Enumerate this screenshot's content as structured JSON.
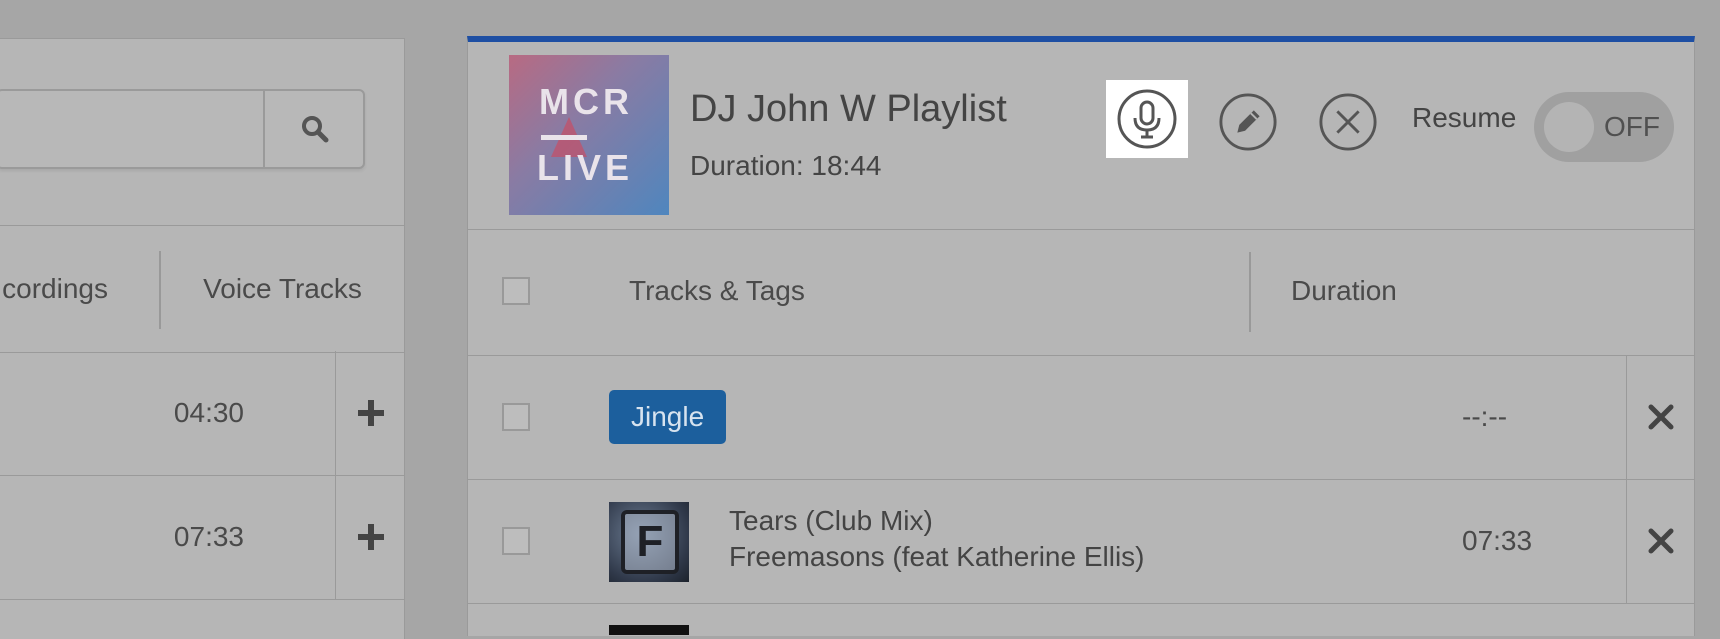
{
  "left": {
    "search": {
      "placeholder": "",
      "value": ""
    },
    "tabs": {
      "recordings": "cordings",
      "voice_tracks": "Voice Tracks"
    },
    "rows": [
      {
        "duration": "04:30"
      },
      {
        "duration": "07:33"
      }
    ]
  },
  "playlist": {
    "cover": {
      "line1": "MCR",
      "line2": "LIVE"
    },
    "title": "DJ John W Playlist",
    "duration": "Duration: 18:44",
    "resume_label": "Resume",
    "toggle_state": "OFF",
    "columns": {
      "tracks": "Tracks & Tags",
      "duration": "Duration"
    },
    "rows": [
      {
        "tag": "Jingle",
        "duration": "--:--"
      },
      {
        "title": "Tears (Club Mix)",
        "artist": "Freemasons (feat Katherine Ellis)",
        "duration": "07:33",
        "thumb_letter": "F"
      }
    ]
  },
  "colors": {
    "accent": "#1e4fa3",
    "tag": "#1c5f9d"
  }
}
